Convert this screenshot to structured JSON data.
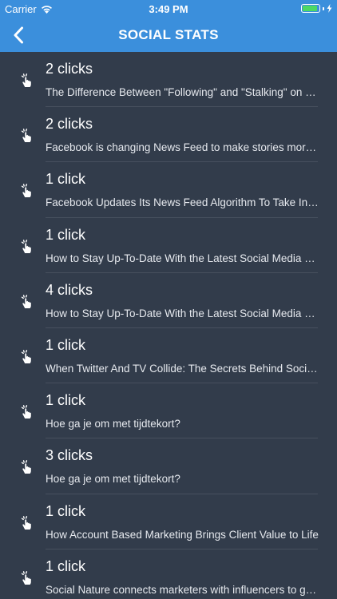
{
  "status_bar": {
    "carrier": "Carrier",
    "time": "3:49 PM",
    "battery_level": 0.9,
    "battery_color": "#4cd964"
  },
  "nav": {
    "title": "SOCIAL STATS",
    "back_icon": "chevron-left-icon",
    "accent_color": "#3b8fdc"
  },
  "rows": [
    {
      "count": "2 clicks",
      "title": "The Difference Between \"Following\" and \"Stalking\" on Social Media",
      "icon": "click-icon"
    },
    {
      "count": "2 clicks",
      "title": "Facebook is changing News Feed to make stories more relevant",
      "icon": "click-icon"
    },
    {
      "count": "1 click",
      "title": "Facebook Updates Its News Feed Algorithm To Take Into Account Time Spent",
      "icon": "click-icon"
    },
    {
      "count": "1 click",
      "title": "How to Stay Up-To-Date With the Latest Social Media News",
      "icon": "click-icon"
    },
    {
      "count": "4 clicks",
      "title": "How to Stay Up-To-Date With the Latest Social Media News",
      "icon": "click-icon"
    },
    {
      "count": "1 click",
      "title": "When Twitter And TV Collide: The Secrets Behind Social TV",
      "icon": "click-icon"
    },
    {
      "count": "1 click",
      "title": "Hoe ga je om met tijdtekort?",
      "icon": "click-icon"
    },
    {
      "count": "3 clicks",
      "title": "Hoe ga je om met tijdtekort?",
      "icon": "click-icon"
    },
    {
      "count": "1 click",
      "title": "How Account Based Marketing Brings Client Value to Life",
      "icon": "click-icon"
    },
    {
      "count": "1 click",
      "title": "Social Nature connects marketers with influencers to grow",
      "icon": "click-icon"
    }
  ]
}
